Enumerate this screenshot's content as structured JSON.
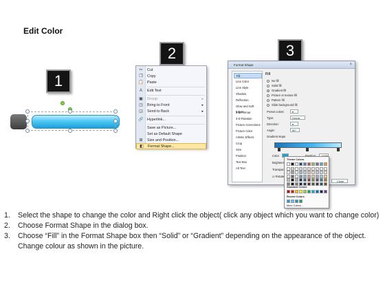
{
  "title": "Edit Color",
  "steps": [
    "1",
    "2",
    "3"
  ],
  "context_menu": {
    "items": [
      {
        "icon": "cut-icon",
        "label": "Cut"
      },
      {
        "icon": "copy-icon",
        "label": "Copy"
      },
      {
        "icon": "paste-icon",
        "label": "Paste"
      },
      {
        "icon": "edit-text-icon",
        "label": "Edit Text"
      },
      {
        "icon": "group-icon",
        "label": "Group",
        "disabled": true
      },
      {
        "icon": "bring-to-front-icon",
        "label": "Bring to Front"
      },
      {
        "icon": "send-to-back-icon",
        "label": "Send to Back"
      },
      {
        "icon": "hyperlink-icon",
        "label": "Hyperlink..."
      },
      {
        "icon": "save-as-picture-icon",
        "label": "Save as Picture..."
      },
      {
        "icon": "",
        "label": "Set as Default Shape"
      },
      {
        "icon": "size-position-icon",
        "label": "Size and Position..."
      },
      {
        "icon": "format-shape-icon",
        "label": "Format Shape..."
      }
    ]
  },
  "dialog": {
    "title": "Format Shape",
    "categories": [
      "Fill",
      "Line Color",
      "Line Style",
      "Shadow",
      "Reflection",
      "Glow and Soft Edges",
      "3-D Format",
      "3-D Rotation",
      "Picture Corrections",
      "Picture Color",
      "Artistic Effects",
      "Crop",
      "Size",
      "Position",
      "Text Box",
      "Alt Text"
    ],
    "section": "Fill",
    "fill_options": [
      "No fill",
      "Solid fill",
      "Gradient fill",
      "Picture or texture fill",
      "Pattern fill",
      "Slide background fill"
    ],
    "selected_fill": "Gradient fill",
    "preset_label": "Preset colors:",
    "type_label": "Type:",
    "type_value": "Linear",
    "direction_label": "Direction:",
    "angle_label": "Angle:",
    "angle_value": "90°",
    "gradient_stops_label": "Gradient stops",
    "color_label": "Color",
    "position_label": "Position:",
    "position_value": "100%",
    "brightness_label": "Brightness",
    "transparency_label": "Transparency",
    "rotate_label": "Rotate with shape",
    "close_label": "Close"
  },
  "color_popup": {
    "theme_label": "Theme Colors",
    "standard_label": "Standard Colors",
    "recent_label": "Recent Colors",
    "more_label": "More Colors...",
    "theme_colors": [
      "#ffffff",
      "#000000",
      "#eeece1",
      "#1f497d",
      "#4f81bd",
      "#c0504d",
      "#9bbb59",
      "#8064a2",
      "#4bacc6",
      "#f79646"
    ],
    "standard_colors": [
      "#c00000",
      "#ff0000",
      "#ffc000",
      "#ffff00",
      "#92d050",
      "#00b050",
      "#00b0f0",
      "#0070c0",
      "#002060",
      "#7030a0"
    ],
    "recent_colors": [
      "#1f9ed8",
      "#4ec8f4",
      "#2a90c4",
      "#00b050"
    ]
  },
  "instructions": [
    {
      "num": "1.",
      "text": "Select the shape to change the color and Right click the object( click any object which you want to change color)"
    },
    {
      "num": "2.",
      "text": "Choose Format Shape in the dialog box."
    },
    {
      "num": "3.",
      "text": "Choose “Fill” in the Format Shape box then “Solid” or “Gradient” depending on the appearance of the object. Change colour as shown in the picture."
    }
  ]
}
